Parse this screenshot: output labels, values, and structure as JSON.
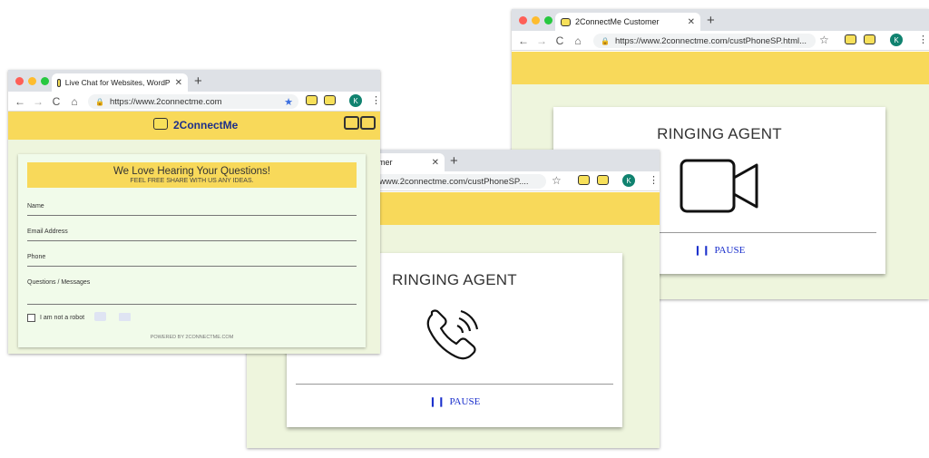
{
  "win1": {
    "tab_title": "Live Chat for Websites, WordP",
    "url": "https://www.2connectme.com",
    "avatar": "K",
    "brand": "2ConnectMe",
    "header_title": "We Love Hearing Your Questions!",
    "header_subtitle": "FEEL FREE SHARE WITH US ANY IDEAS.",
    "fields": [
      "Name",
      "Email Address",
      "Phone",
      "Questions / Messages"
    ],
    "captcha_label": "I am not a robot",
    "powered_by": "POWERED BY 2CONNECTME.COM"
  },
  "win2": {
    "tab_title": "omer",
    "url": "www.2connectme.com/custPhoneSP....",
    "avatar": "K",
    "ringing": "RINGING AGENT",
    "pause": "PAUSE"
  },
  "win3": {
    "tab_title": "2ConnectMe Customer",
    "url": "https://www.2connectme.com/custPhoneSP.html...",
    "avatar": "K",
    "ringing": "RINGING AGENT",
    "pause": "PAUSE"
  },
  "colors": {
    "yellow": "#f8d95a",
    "green": "#eef5dd",
    "pause_blue": "#1a2fcc"
  }
}
